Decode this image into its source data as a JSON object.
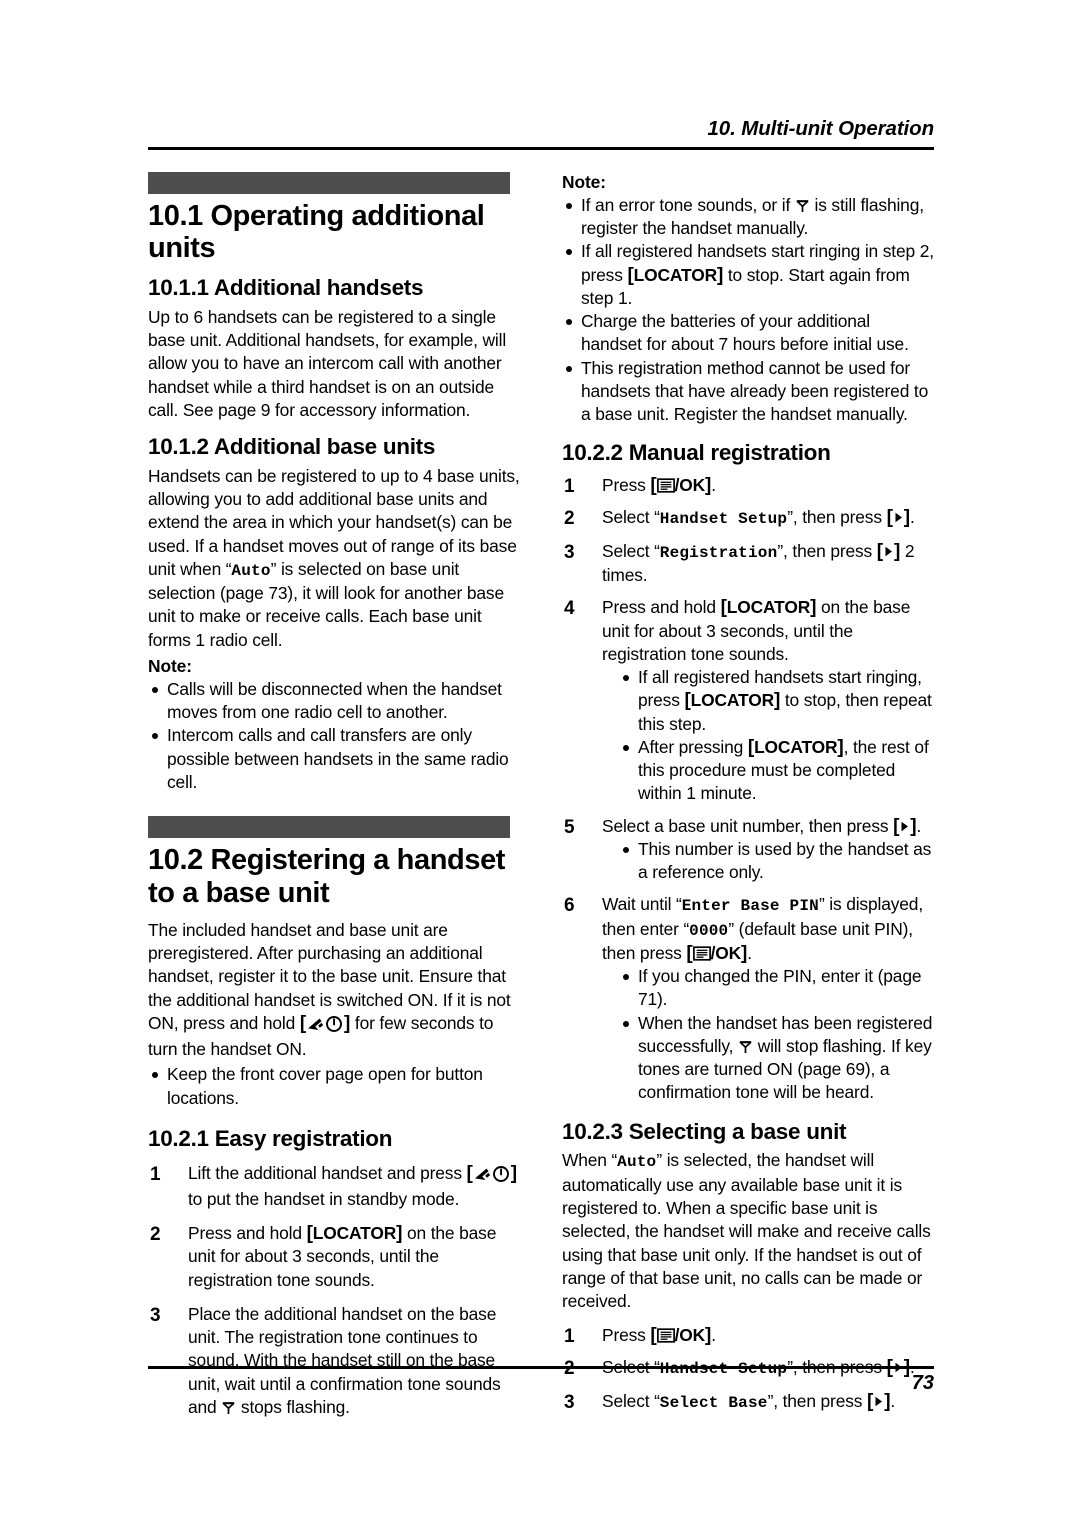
{
  "header": {
    "chapter_title": "10. Multi-unit Operation"
  },
  "footer": {
    "page_number": "73"
  },
  "left_column": {
    "section_10_1": {
      "title": "10.1 Operating additional units",
      "sub_10_1_1": {
        "title": "10.1.1 Additional handsets",
        "body": "Up to 6 handsets can be registered to a single base unit. Additional handsets, for example, will allow you to have an intercom call with another handset while a third handset is on an outside call. See page 9 for accessory information."
      },
      "sub_10_1_2": {
        "title": "10.1.2 Additional base units",
        "body_part1": "Handsets can be registered to up to 4 base units, allowing you to add additional base units and extend the area in which your handset(s) can be used. If a handset moves out of range of its base unit when “",
        "body_auto": "Auto",
        "body_part2": "” is selected on base unit selection (page 73), it will look for another base unit to make or receive calls. Each base unit forms 1 radio cell.",
        "note_label": "Note:",
        "notes": [
          "Calls will be disconnected when the handset moves from one radio cell to another.",
          "Intercom calls and call transfers are only possible between handsets in the same radio cell."
        ]
      }
    },
    "section_10_2": {
      "title": "10.2 Registering a handset to a base unit",
      "body_part1": "The included handset and base unit are preregistered. After purchasing an additional handset, register it to the base unit. Ensure that the additional handset is switched ON. If it is not ON, press and hold ",
      "body_part2": " for few seconds to turn the handset ON.",
      "notes": [
        "Keep the front cover page open for button locations."
      ],
      "sub_10_2_1": {
        "title": "10.2.1 Easy registration",
        "steps": [
          {
            "num": "1",
            "text_part1": "Lift the additional handset and press ",
            "text_part2": " to put the handset in standby mode."
          },
          {
            "num": "2",
            "text_part1": "Press and hold ",
            "key": "LOCATOR",
            "text_part2": " on the base unit for about 3 seconds, until the registration tone sounds."
          },
          {
            "num": "3",
            "text_part1": "Place the additional handset on the base unit. The registration tone continues to sound. With the handset still on the base unit, wait until a confirmation tone sounds and ",
            "text_part2": " stops flashing."
          }
        ]
      }
    }
  },
  "right_column": {
    "note_top": {
      "label": "Note:",
      "items": [
        {
          "part1": "If an error tone sounds, or if ",
          "part2": " is still flashing, register the handset manually."
        },
        {
          "part1": "If all registered handsets start ringing in step 2, press ",
          "key": "LOCATOR",
          "part2": " to stop. Start again from step 1."
        },
        {
          "part1": "Charge the batteries of your additional handset for about 7 hours before initial use."
        },
        {
          "part1": "This registration method cannot be used for handsets that have already been registered to a base unit. Register the handset manually."
        }
      ]
    },
    "sub_10_2_2": {
      "title": "10.2.2 Manual registration",
      "steps": [
        {
          "num": "1",
          "text_part1": "Press ",
          "text_part2": "."
        },
        {
          "num": "2",
          "text_part1": "Select “",
          "mono": "Handset Setup",
          "text_part2": "”, then press ",
          "text_part3": "."
        },
        {
          "num": "3",
          "text_part1": "Select “",
          "mono": "Registration",
          "text_part2": "”, then press ",
          "text_part3": " 2 times."
        },
        {
          "num": "4",
          "text_part1": "Press and hold ",
          "key": "LOCATOR",
          "text_part2": " on the base unit for about 3 seconds, until the registration tone sounds.",
          "subnotes": [
            {
              "part1": "If all registered handsets start ringing, press ",
              "key": "LOCATOR",
              "part2": " to stop, then repeat this step."
            },
            {
              "part1": "After pressing ",
              "key": "LOCATOR",
              "part2": ", the rest of this procedure must be completed within 1 minute."
            }
          ]
        },
        {
          "num": "5",
          "text_part1": "Select a base unit number, then press ",
          "text_part2": ".",
          "subnotes": [
            {
              "part1": "This number is used by the handset as a reference only."
            }
          ]
        },
        {
          "num": "6",
          "text_part1": "Wait until “",
          "mono": "Enter Base PIN",
          "text_part2": "” is displayed, then enter “",
          "mono2": "0000",
          "text_part3": "” (default base unit PIN), then press ",
          "text_part4": ".",
          "subnotes": [
            {
              "part1": "If you changed the PIN, enter it (page 71)."
            },
            {
              "part1": "When the handset has been registered successfully, ",
              "part2": " will stop flashing. If key tones are turned ON (page 69), a confirmation tone will be heard."
            }
          ]
        }
      ]
    },
    "sub_10_2_3": {
      "title": "10.2.3 Selecting a base unit",
      "body_part1": "When “",
      "body_auto": "Auto",
      "body_part2": "” is selected, the handset will automatically use any available base unit it is registered to. When a specific base unit is selected, the handset will make and receive calls using that base unit only. If the handset is out of range of that base unit, no calls can be made or received.",
      "steps": [
        {
          "num": "1",
          "text_part1": "Press ",
          "text_part2": "."
        },
        {
          "num": "2",
          "text_part1": "Select “",
          "mono": "Handset Setup",
          "text_part2": "”, then press ",
          "text_part3": "."
        },
        {
          "num": "3",
          "text_part1": "Select “",
          "mono": "Select Base",
          "text_part2": "”, then press ",
          "text_part3": "."
        }
      ]
    }
  },
  "icons": {
    "antenna": "antenna-icon",
    "menu_ok": "menu-ok-icon",
    "talk_power": "talk-power-icon",
    "right_arrow": "right-arrow-icon"
  },
  "colors": {
    "banner": "#4d4d4d",
    "text": "#000000",
    "background": "#ffffff"
  }
}
